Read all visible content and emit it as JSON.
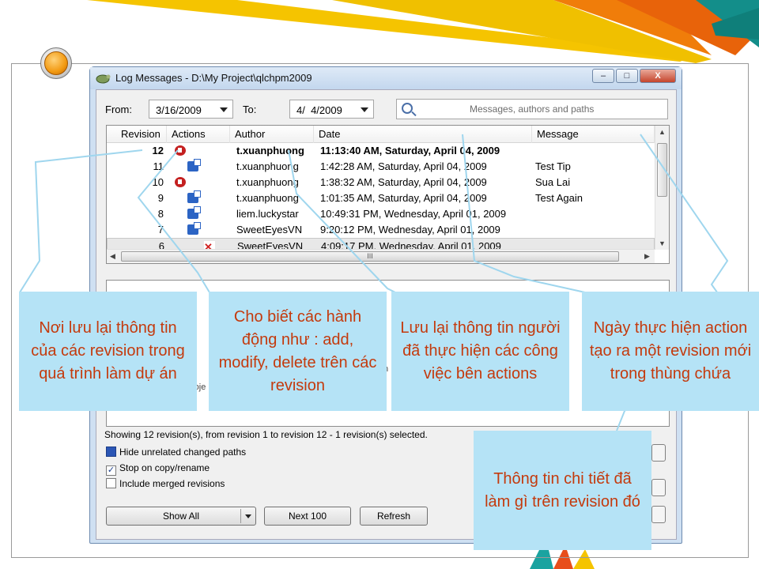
{
  "window": {
    "title": "Log Messages - D:\\My Project\\qlchpm2009",
    "minimize": "–",
    "maximize": "□",
    "close": "X"
  },
  "filters": {
    "from_label": "From:",
    "from_value": "3/16/2009",
    "to_label": "To:",
    "to_value": "4/  4/2009",
    "search_placeholder": "Messages, authors and paths"
  },
  "columns": [
    "Revision",
    "Actions",
    "Author",
    "Date",
    "Message"
  ],
  "rows": [
    {
      "revision": "12",
      "actions": [
        "modify"
      ],
      "author": "t.xuanphuong",
      "date": "11:13:40 AM, Saturday, April 04, 2009",
      "message": "",
      "bold": true
    },
    {
      "revision": "11",
      "actions": [
        "add"
      ],
      "author": "t.xuanphuong",
      "date": "1:42:28 AM, Saturday, April 04, 2009",
      "message": "Test Tip"
    },
    {
      "revision": "10",
      "actions": [
        "modify"
      ],
      "author": "t.xuanphuong",
      "date": "1:38:32 AM, Saturday, April 04, 2009",
      "message": "Sua Lai"
    },
    {
      "revision": "9",
      "actions": [
        "add"
      ],
      "author": "t.xuanphuong",
      "date": "1:01:35 AM, Saturday, April 04, 2009",
      "message": "Test Again"
    },
    {
      "revision": "8",
      "actions": [
        "add"
      ],
      "author": "liem.luckystar",
      "date": "10:49:31 PM, Wednesday, April 01, 2009",
      "message": ""
    },
    {
      "revision": "7",
      "actions": [
        "add"
      ],
      "author": "SweetEyesVN",
      "date": "9:20:12 PM, Wednesday, April 01, 2009",
      "message": ""
    },
    {
      "revision": "6",
      "actions": [
        "delete"
      ],
      "author": "SweetEyesVN",
      "date": "4:09:17 PM, Wednesday, April 01, 2009",
      "message": "",
      "selected": true
    }
  ],
  "scrollbar_grip": "III",
  "peek": {
    "text_a": "roje",
    "text_b": "th"
  },
  "status": "Showing 12 revision(s), from revision 1 to revision 12 - 1 revision(s) selected.",
  "checkboxes": [
    {
      "label": "Hide unrelated changed paths",
      "checked": true
    },
    {
      "label": "Stop on copy/rename",
      "checked": true
    },
    {
      "label": "Include merged revisions",
      "checked": false
    }
  ],
  "buttons": {
    "show_all": "Show All",
    "next_100": "Next 100",
    "refresh": "Refresh"
  },
  "callouts": [
    "Nơi lưu lại thông tin của các revision trong quá trình làm dự án",
    "Cho biết các hành động như : add, modify, delete  trên các revision",
    "Lưu lại thông tin người đã thực hiện các công việc bên actions",
    "Ngày thực hiện action tạo ra một revision mới trong thùng chứa",
    "Thông tin chi tiết đã làm gì trên revision đó"
  ],
  "colors": {
    "callout_bg": "#b5e3f6",
    "callout_text": "#c43a0d",
    "deco_yellow": "#f5c400",
    "deco_orange": "#f07d0a",
    "deco_teal": "#138e8a"
  }
}
